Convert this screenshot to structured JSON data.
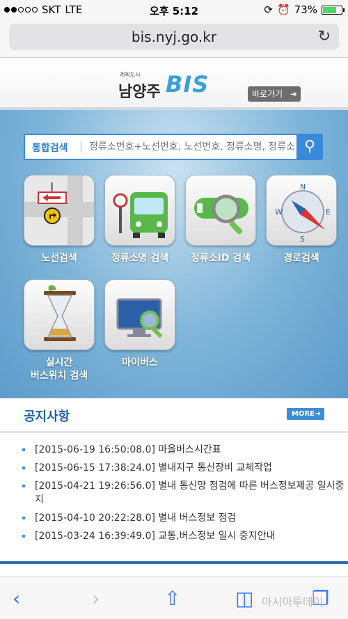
{
  "status": {
    "carrier": "SKT",
    "network": "LTE",
    "time": "오후 5:12",
    "battery": "73%"
  },
  "browser": {
    "url": "bis.nyj.go.kr"
  },
  "header": {
    "logo_small": "계획도시",
    "logo_city": "남양주",
    "logo_bis": "BIS",
    "goto_label": "바로가기"
  },
  "search": {
    "label": "통합검색",
    "placeholder": "정류소번호+노선번호, 노선번호, 정류소명, 정류소"
  },
  "menu": [
    {
      "label": "노선검색"
    },
    {
      "label": "정류소명 검색"
    },
    {
      "label": "정류소ID 검색"
    },
    {
      "label": "경로검색"
    },
    {
      "label": "실시간",
      "label2": "버스위치 검색"
    },
    {
      "label": "마이버스"
    }
  ],
  "notice": {
    "title": "공지사항",
    "more": "MORE",
    "items": [
      "[2015-06-19 16:50:08.0] 마을버스시간표",
      "[2015-06-15 17:38:24.0] 별내지구 통신장비 교체작업",
      "[2015-04-21 19:26:56.0] 별내 통신망 점검에 따른 버스정보제공 일시중지",
      "[2015-04-10 20:22:28.0] 별내 버스정보 점검",
      "[2015-03-24 16:39:49.0] 교통,버스정보 일시 중지안내"
    ]
  },
  "toolbar": {
    "watermark": "아시아투데이"
  }
}
